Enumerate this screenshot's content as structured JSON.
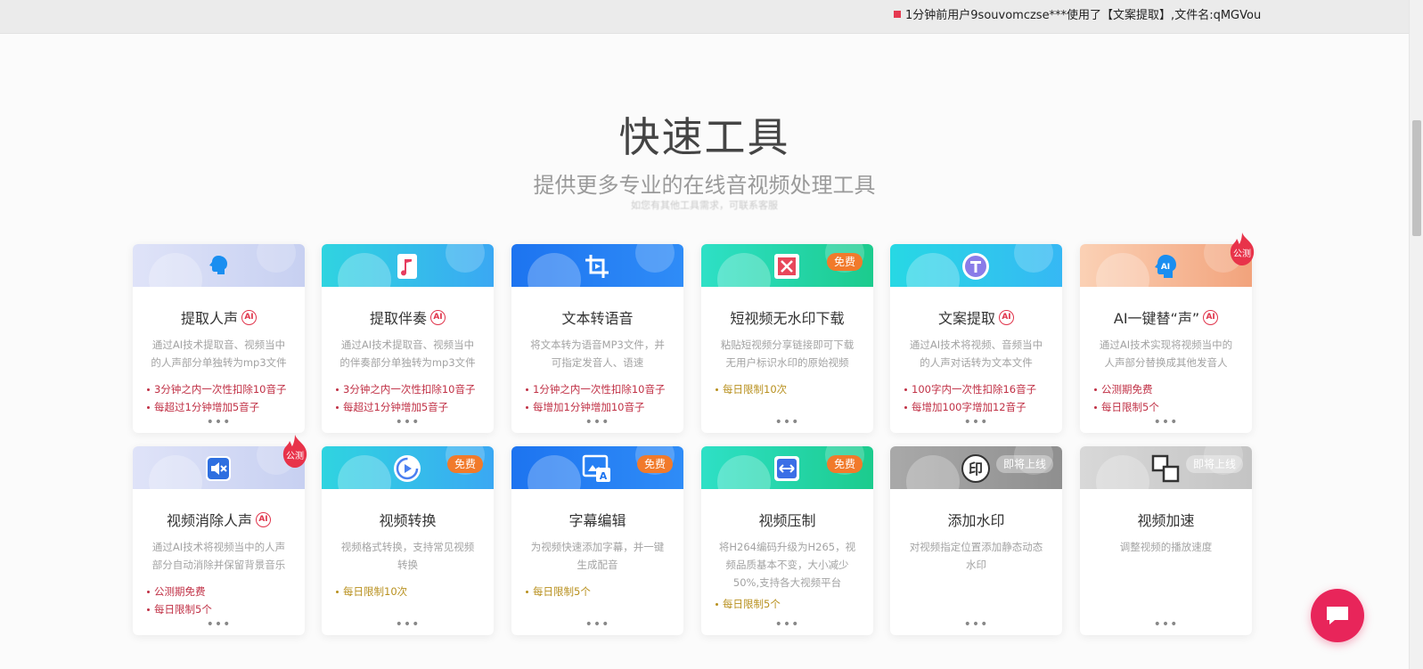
{
  "ticker": {
    "text": "1分钟前用户9souvomczse***使用了【文案提取】,文件名:qMGVou"
  },
  "header": {
    "title": "快速工具",
    "subtitle": "提供更多专业的在线音视频处理工具",
    "note": "如您有其他工具需求，可联系客服"
  },
  "cards": [
    {
      "title": "提取人声",
      "desc": "通过AI技术提取音、视频当中的人声部分单独转为mp3文件",
      "bullets": [
        "3分钟之内一次性扣除10音子",
        "每超过1分钟增加5音子"
      ]
    },
    {
      "title": "提取伴奏",
      "desc": "通过AI技术提取音、视频当中的伴奏部分单独转为mp3文件",
      "bullets": [
        "3分钟之内一次性扣除10音子",
        "每超过1分钟增加5音子"
      ]
    },
    {
      "title": "文本转语音",
      "desc": "将文本转为语音MP3文件，并可指定发音人、语速",
      "bullets": [
        "1分钟之内一次性扣除10音子",
        "每增加1分钟增加10音子"
      ]
    },
    {
      "title": "短视频无水印下载",
      "badge": "免费",
      "desc": "粘贴短视频分享链接即可下载无用户标识水印的原始视频",
      "bullets": [
        "每日限制10次"
      ]
    },
    {
      "title": "文案提取",
      "desc": "通过AI技术将视频、音频当中的人声对话转为文本文件",
      "bullets": [
        "100字内一次性扣除16音子",
        "每增加100字增加12音子"
      ]
    },
    {
      "title": "AI一键替“声”",
      "flame": "公测",
      "desc": "通过AI技术实现将视频当中的人声部分替换成其他发音人",
      "bullets": [
        "公测期免费",
        "每日限制5个"
      ]
    },
    {
      "title": "视频消除人声",
      "flame": "公测",
      "desc": "通过AI技术将视频当中的人声部分自动消除并保留背景音乐",
      "bullets": [
        "公测期免费",
        "每日限制5个"
      ]
    },
    {
      "title": "视频转换",
      "badge": "免费",
      "desc": "视频格式转换，支持常见视频转换",
      "bullets": [
        "每日限制10次"
      ]
    },
    {
      "title": "字幕编辑",
      "badge": "免费",
      "desc": "为视频快速添加字幕，并一键生成配音",
      "bullets": [
        "每日限制5个"
      ]
    },
    {
      "title": "视频压制",
      "badge": "免费",
      "desc": "将H264编码升级为H265，视频品质基本不变，大小减少50%,支持各大视频平台",
      "bullets": [
        "每日限制5个"
      ]
    },
    {
      "title": "添加水印",
      "badge": "即将上线",
      "desc": "对视频指定位置添加静态动态水印",
      "bullets": []
    },
    {
      "title": "视频加速",
      "badge": "即将上线",
      "desc": "调整视频的播放速度",
      "bullets": []
    }
  ],
  "more_label": "•••",
  "ai_label": "AI"
}
